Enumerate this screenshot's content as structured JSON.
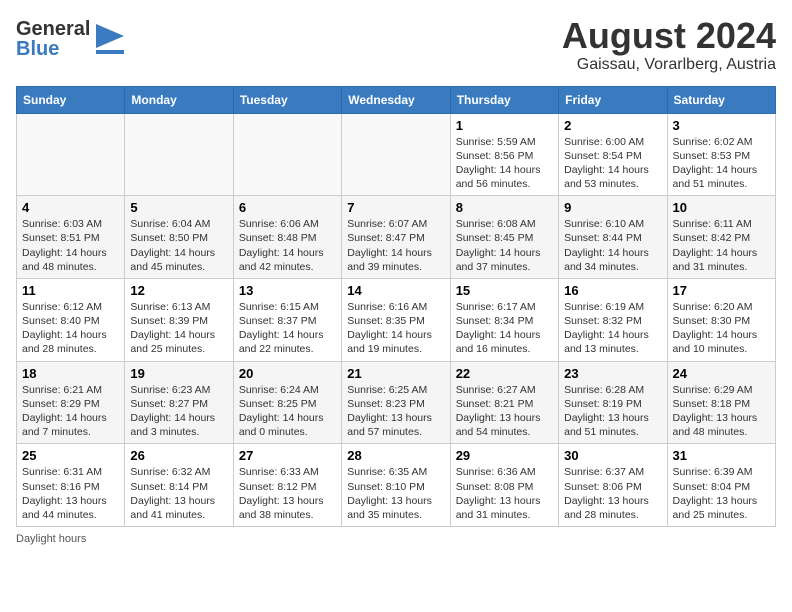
{
  "header": {
    "logo_general": "General",
    "logo_blue": "Blue",
    "main_title": "August 2024",
    "sub_title": "Gaissau, Vorarlberg, Austria"
  },
  "days_of_week": [
    "Sunday",
    "Monday",
    "Tuesday",
    "Wednesday",
    "Thursday",
    "Friday",
    "Saturday"
  ],
  "weeks": [
    {
      "days": [
        {
          "num": "",
          "info": ""
        },
        {
          "num": "",
          "info": ""
        },
        {
          "num": "",
          "info": ""
        },
        {
          "num": "",
          "info": ""
        },
        {
          "num": "1",
          "info": "Sunrise: 5:59 AM\nSunset: 8:56 PM\nDaylight: 14 hours\nand 56 minutes."
        },
        {
          "num": "2",
          "info": "Sunrise: 6:00 AM\nSunset: 8:54 PM\nDaylight: 14 hours\nand 53 minutes."
        },
        {
          "num": "3",
          "info": "Sunrise: 6:02 AM\nSunset: 8:53 PM\nDaylight: 14 hours\nand 51 minutes."
        }
      ]
    },
    {
      "days": [
        {
          "num": "4",
          "info": "Sunrise: 6:03 AM\nSunset: 8:51 PM\nDaylight: 14 hours\nand 48 minutes."
        },
        {
          "num": "5",
          "info": "Sunrise: 6:04 AM\nSunset: 8:50 PM\nDaylight: 14 hours\nand 45 minutes."
        },
        {
          "num": "6",
          "info": "Sunrise: 6:06 AM\nSunset: 8:48 PM\nDaylight: 14 hours\nand 42 minutes."
        },
        {
          "num": "7",
          "info": "Sunrise: 6:07 AM\nSunset: 8:47 PM\nDaylight: 14 hours\nand 39 minutes."
        },
        {
          "num": "8",
          "info": "Sunrise: 6:08 AM\nSunset: 8:45 PM\nDaylight: 14 hours\nand 37 minutes."
        },
        {
          "num": "9",
          "info": "Sunrise: 6:10 AM\nSunset: 8:44 PM\nDaylight: 14 hours\nand 34 minutes."
        },
        {
          "num": "10",
          "info": "Sunrise: 6:11 AM\nSunset: 8:42 PM\nDaylight: 14 hours\nand 31 minutes."
        }
      ]
    },
    {
      "days": [
        {
          "num": "11",
          "info": "Sunrise: 6:12 AM\nSunset: 8:40 PM\nDaylight: 14 hours\nand 28 minutes."
        },
        {
          "num": "12",
          "info": "Sunrise: 6:13 AM\nSunset: 8:39 PM\nDaylight: 14 hours\nand 25 minutes."
        },
        {
          "num": "13",
          "info": "Sunrise: 6:15 AM\nSunset: 8:37 PM\nDaylight: 14 hours\nand 22 minutes."
        },
        {
          "num": "14",
          "info": "Sunrise: 6:16 AM\nSunset: 8:35 PM\nDaylight: 14 hours\nand 19 minutes."
        },
        {
          "num": "15",
          "info": "Sunrise: 6:17 AM\nSunset: 8:34 PM\nDaylight: 14 hours\nand 16 minutes."
        },
        {
          "num": "16",
          "info": "Sunrise: 6:19 AM\nSunset: 8:32 PM\nDaylight: 14 hours\nand 13 minutes."
        },
        {
          "num": "17",
          "info": "Sunrise: 6:20 AM\nSunset: 8:30 PM\nDaylight: 14 hours\nand 10 minutes."
        }
      ]
    },
    {
      "days": [
        {
          "num": "18",
          "info": "Sunrise: 6:21 AM\nSunset: 8:29 PM\nDaylight: 14 hours\nand 7 minutes."
        },
        {
          "num": "19",
          "info": "Sunrise: 6:23 AM\nSunset: 8:27 PM\nDaylight: 14 hours\nand 3 minutes."
        },
        {
          "num": "20",
          "info": "Sunrise: 6:24 AM\nSunset: 8:25 PM\nDaylight: 14 hours\nand 0 minutes."
        },
        {
          "num": "21",
          "info": "Sunrise: 6:25 AM\nSunset: 8:23 PM\nDaylight: 13 hours\nand 57 minutes."
        },
        {
          "num": "22",
          "info": "Sunrise: 6:27 AM\nSunset: 8:21 PM\nDaylight: 13 hours\nand 54 minutes."
        },
        {
          "num": "23",
          "info": "Sunrise: 6:28 AM\nSunset: 8:19 PM\nDaylight: 13 hours\nand 51 minutes."
        },
        {
          "num": "24",
          "info": "Sunrise: 6:29 AM\nSunset: 8:18 PM\nDaylight: 13 hours\nand 48 minutes."
        }
      ]
    },
    {
      "days": [
        {
          "num": "25",
          "info": "Sunrise: 6:31 AM\nSunset: 8:16 PM\nDaylight: 13 hours\nand 44 minutes."
        },
        {
          "num": "26",
          "info": "Sunrise: 6:32 AM\nSunset: 8:14 PM\nDaylight: 13 hours\nand 41 minutes."
        },
        {
          "num": "27",
          "info": "Sunrise: 6:33 AM\nSunset: 8:12 PM\nDaylight: 13 hours\nand 38 minutes."
        },
        {
          "num": "28",
          "info": "Sunrise: 6:35 AM\nSunset: 8:10 PM\nDaylight: 13 hours\nand 35 minutes."
        },
        {
          "num": "29",
          "info": "Sunrise: 6:36 AM\nSunset: 8:08 PM\nDaylight: 13 hours\nand 31 minutes."
        },
        {
          "num": "30",
          "info": "Sunrise: 6:37 AM\nSunset: 8:06 PM\nDaylight: 13 hours\nand 28 minutes."
        },
        {
          "num": "31",
          "info": "Sunrise: 6:39 AM\nSunset: 8:04 PM\nDaylight: 13 hours\nand 25 minutes."
        }
      ]
    }
  ],
  "footer": {
    "daylight_label": "Daylight hours"
  }
}
